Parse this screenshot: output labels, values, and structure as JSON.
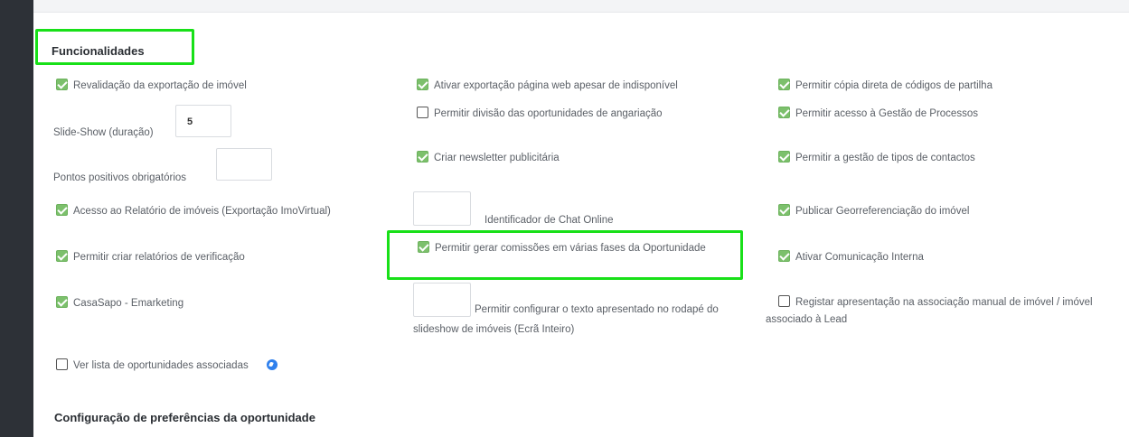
{
  "sections": {
    "funcionalidades": "Funcionalidades",
    "preferencias": "Configuração de preferências da oportunidade"
  },
  "col1": {
    "revalidacao": "Revalidação da exportação de imóvel",
    "slideshow_label": "Slide-Show (duração)",
    "slideshow_value": "5",
    "pontos_label": "Pontos positivos obrigatórios",
    "pontos_value": "",
    "acesso_relatorio": "Acesso ao Relatório de imóveis (Exportação ImoVirtual)",
    "relatorios_verificacao": "Permitir criar relatórios de verificação",
    "casasapo": "CasaSapo - Emarketing",
    "ver_lista": "Ver lista de oportunidades associadas"
  },
  "col2": {
    "ativar_exportacao": "Ativar exportação página web apesar de indisponível",
    "divisao": "Permitir divisão das oportunidades de angariação",
    "newsletter": "Criar newsletter publicitária",
    "chat_label": "Identificador de Chat Online",
    "chat_value": "",
    "comissoes": "Permitir gerar comissões em várias fases da Oportunidade",
    "texto_label": "Permitir configurar o texto apresentado no rodapé do slideshow de imóveis (Ecrã Inteiro)",
    "texto_value": ""
  },
  "col3": {
    "copia": "Permitir cópia direta de códigos de partilha",
    "gestao_processos": "Permitir acesso à Gestão de Processos",
    "gestao_contactos": "Permitir a gestão de tipos de contactos",
    "georreferenciacao": "Publicar Georreferenciação do imóvel",
    "comunicacao": "Ativar Comunicação Interna",
    "registar": "Registar apresentação na associação manual de imóvel / imóvel associado à Lead"
  },
  "colors": {
    "highlight": "#18e018",
    "checkbox_on": "#7cc06c",
    "sidebar": "#2d3137",
    "info_icon": "#2f80ed"
  }
}
